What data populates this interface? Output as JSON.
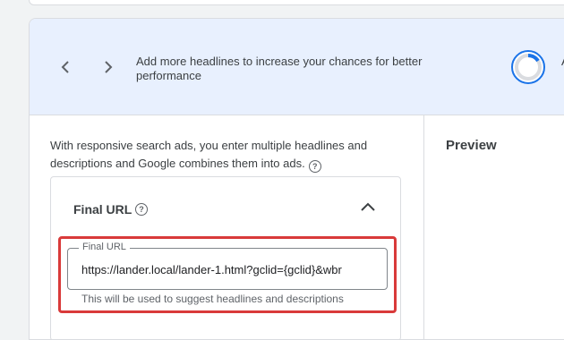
{
  "banner": {
    "message": "Add more headlines to increase your chances for better performance",
    "cut_text": "A"
  },
  "intro": {
    "text": "With responsive search ads, you enter multiple headlines and descriptions and Google combines them into ads."
  },
  "preview": {
    "title": "Preview"
  },
  "final_url": {
    "section_title": "Final URL",
    "field_label": "Final URL",
    "value": "https://lander.local/lander-1.html?gclid={gclid}&wbr",
    "hint": "This will be used to suggest headlines and descriptions"
  },
  "colors": {
    "banner_bg": "#e8f0fe",
    "accent": "#1a73e8",
    "highlight": "#d93a3a"
  },
  "icons": [
    "chevron-left-icon",
    "chevron-right-icon",
    "progress-ring-icon",
    "help-icon",
    "chevron-up-icon"
  ]
}
